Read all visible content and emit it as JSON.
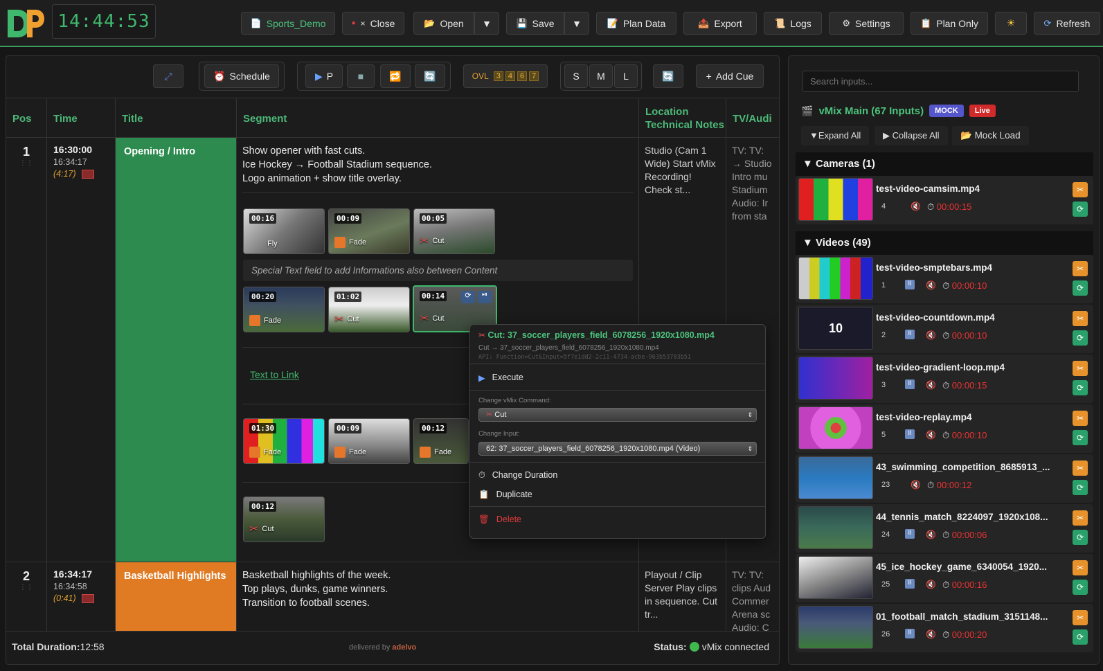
{
  "header": {
    "clock": "14:44:53",
    "project": "Sports_Demo",
    "buttons": {
      "close": "Close",
      "open": "Open",
      "save": "Save",
      "plan_data": "Plan Data",
      "export": "Export",
      "logs": "Logs",
      "settings": "Settings",
      "plan_only": "Plan Only",
      "refresh": "Refresh"
    }
  },
  "toolbar": {
    "schedule": "Schedule",
    "play_p": "P",
    "ovl_label": "OVL",
    "ovl_nums": [
      "3",
      "4",
      "6",
      "7"
    ],
    "sizes": [
      "S",
      "M",
      "L"
    ],
    "add_cue": "Add Cue"
  },
  "columns": {
    "pos": "Pos",
    "time": "Time",
    "title": "Title",
    "segment": "Segment",
    "location": "Location Technical Notes",
    "tv": "TV/Audi"
  },
  "rows": [
    {
      "pos": "1",
      "start": "16:30:00",
      "end": "16:34:17",
      "dur": "(4:17)",
      "title": "Opening / Intro",
      "segment_lines": [
        "Show opener with fast cuts.",
        "Ice Hockey → Football Stadium sequence.",
        "Logo animation + show title overlay."
      ],
      "location": "Studio (Cam 1 Wide) Start vMix Recording! Check st...",
      "tv": "TV: TV: → Studio Intro mu Stadium Audio: Ir from sta",
      "note": "Special Text field to add Informations also between Content",
      "link": "Text to Link",
      "clips_a": [
        {
          "time": "00:16",
          "trans": "Fly"
        },
        {
          "time": "00:09",
          "trans": "Fade"
        },
        {
          "time": "00:05",
          "trans": "Cut"
        }
      ],
      "clips_b": [
        {
          "time": "00:20",
          "trans": "Fade"
        },
        {
          "time": "01:02",
          "trans": "Cut"
        },
        {
          "time": "00:14",
          "trans": "Cut"
        }
      ],
      "clips_c": [
        {
          "time": "01:30",
          "trans": "Fade"
        },
        {
          "time": "00:09",
          "trans": "Fade"
        },
        {
          "time": "00:12",
          "trans": "Fade"
        }
      ],
      "clips_d": [
        {
          "time": "00:12",
          "trans": "Cut"
        }
      ]
    },
    {
      "pos": "2",
      "start": "16:34:17",
      "end": "16:34:58",
      "dur": "(0:41)",
      "title": "Basketball Highlights",
      "segment_lines": [
        "Basketball highlights of the week.",
        "Top plays, dunks, game winners.",
        "Transition to football scenes."
      ],
      "location": "Playout / Clip Server Play clips in sequence. Cut tr...",
      "tv": "TV: TV: clips Aud Commer Arena sc Audio: C"
    }
  ],
  "context_menu": {
    "title": "Cut: 37_soccer_players_field_6078256_1920x1080.mp4",
    "subtitle": "Cut → 37_soccer_players_field_6078256_1920x1080.mp4",
    "api": "API: Function=Cut&Input=5f7e1dd2-2c11-4734-acbe-963b53783b51",
    "execute": "Execute",
    "cmd_label": "Change vMix Command:",
    "cmd_value": "Cut",
    "input_label": "Change Input:",
    "input_value": "62: 37_soccer_players_field_6078256_1920x1080.mp4 (Video)",
    "change_duration": "Change Duration",
    "duplicate": "Duplicate",
    "delete": "Delete"
  },
  "footer": {
    "total_label": "Total Duration:",
    "total_value": "12:58",
    "delivered": "delivered by",
    "brand": "adelvo",
    "status_label": "Status:",
    "status_value": "vMix connected"
  },
  "inputs": {
    "search_placeholder": "Search inputs...",
    "title": "vMix Main (67 Inputs)",
    "mock_badge": "MOCK",
    "live_badge": "Live",
    "expand": "Expand All",
    "collapse": "Collapse All",
    "mock_load": "Mock Load",
    "cameras_header": "Cameras (1)",
    "videos_header": "Videos (49)",
    "cameras": [
      {
        "name": "test-video-camsim.mp4",
        "num": "4",
        "dur": "00:00:15"
      }
    ],
    "videos": [
      {
        "name": "test-video-smptebars.mp4",
        "num": "1",
        "dur": "00:00:10"
      },
      {
        "name": "test-video-countdown.mp4",
        "num": "2",
        "dur": "00:00:10",
        "thumb_text": "10"
      },
      {
        "name": "test-video-gradient-loop.mp4",
        "num": "3",
        "dur": "00:00:15"
      },
      {
        "name": "test-video-replay.mp4",
        "num": "5",
        "dur": "00:00:10"
      },
      {
        "name": "43_swimming_competition_8685913_...",
        "num": "23",
        "dur": "00:00:12"
      },
      {
        "name": "44_tennis_match_8224097_1920x108...",
        "num": "24",
        "dur": "00:00:06"
      },
      {
        "name": "45_ice_hockey_game_6340054_1920...",
        "num": "25",
        "dur": "00:00:16"
      },
      {
        "name": "01_football_match_stadium_3151148...",
        "num": "26",
        "dur": "00:00:20"
      }
    ]
  },
  "colors": {
    "accent": "#4cc37c",
    "row1_title": "#2e8b4f",
    "row2_title": "#e07b24",
    "danger": "#e03b3b",
    "mock": "#5555cc"
  }
}
